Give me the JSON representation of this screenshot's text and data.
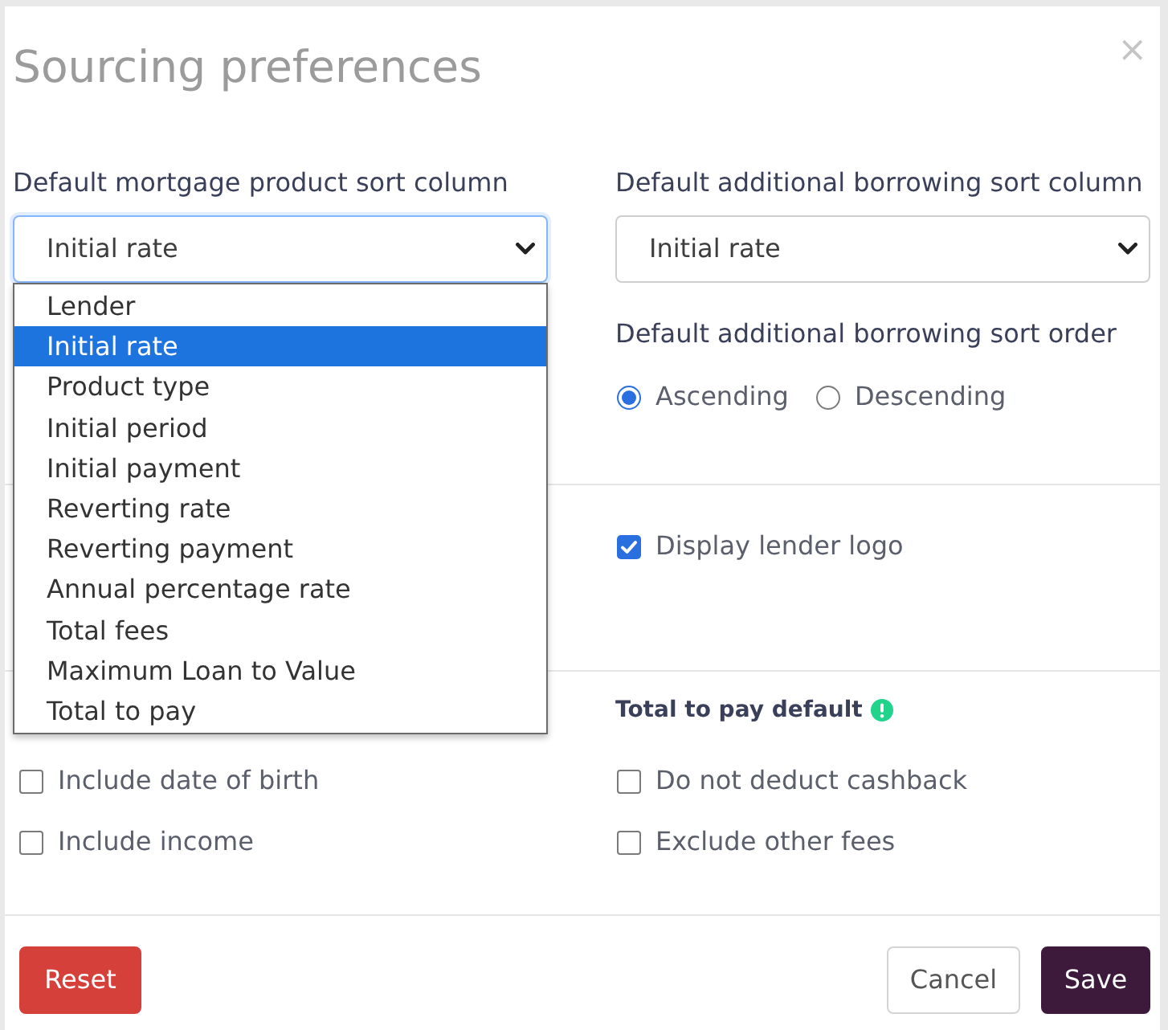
{
  "dialog": {
    "title": "Sourcing preferences",
    "close": "×"
  },
  "mortgage_sort": {
    "label": "Default mortgage product sort column",
    "value": "Initial rate",
    "focused": true,
    "expanded": true,
    "options": [
      {
        "label": "Lender",
        "selected": false
      },
      {
        "label": "Initial rate",
        "selected": true
      },
      {
        "label": "Product type",
        "selected": false
      },
      {
        "label": "Initial period",
        "selected": false
      },
      {
        "label": "Initial payment",
        "selected": false
      },
      {
        "label": "Reverting rate",
        "selected": false
      },
      {
        "label": "Reverting payment",
        "selected": false
      },
      {
        "label": "Annual percentage rate",
        "selected": false
      },
      {
        "label": "Total fees",
        "selected": false
      },
      {
        "label": "Maximum Loan to Value",
        "selected": false
      },
      {
        "label": "Total to pay",
        "selected": false
      }
    ]
  },
  "borrowing_sort": {
    "label": "Default additional borrowing sort column",
    "value": "Initial rate",
    "focused": false,
    "expanded": false
  },
  "borrowing_sort_order": {
    "label": "Default additional borrowing sort order",
    "options": [
      {
        "label": "Ascending",
        "selected": true
      },
      {
        "label": "Descending",
        "selected": false
      }
    ]
  },
  "display": {
    "checkboxes": [
      {
        "label": "Display lender logo",
        "checked": true
      }
    ]
  },
  "section_3_left": {
    "checkboxes": [
      {
        "label": "Include date of birth",
        "checked": false
      },
      {
        "label": "Include income",
        "checked": false
      }
    ]
  },
  "total_to_pay_default": {
    "heading": "Total to pay default",
    "checkboxes": [
      {
        "label": "Do not deduct cashback",
        "checked": false
      },
      {
        "label": "Exclude other fees",
        "checked": false
      }
    ]
  },
  "buttons": [
    {
      "label": "Reset",
      "kind": "danger"
    },
    {
      "label": "Cancel",
      "kind": "secondary"
    },
    {
      "label": "Save",
      "kind": "primary"
    }
  ]
}
